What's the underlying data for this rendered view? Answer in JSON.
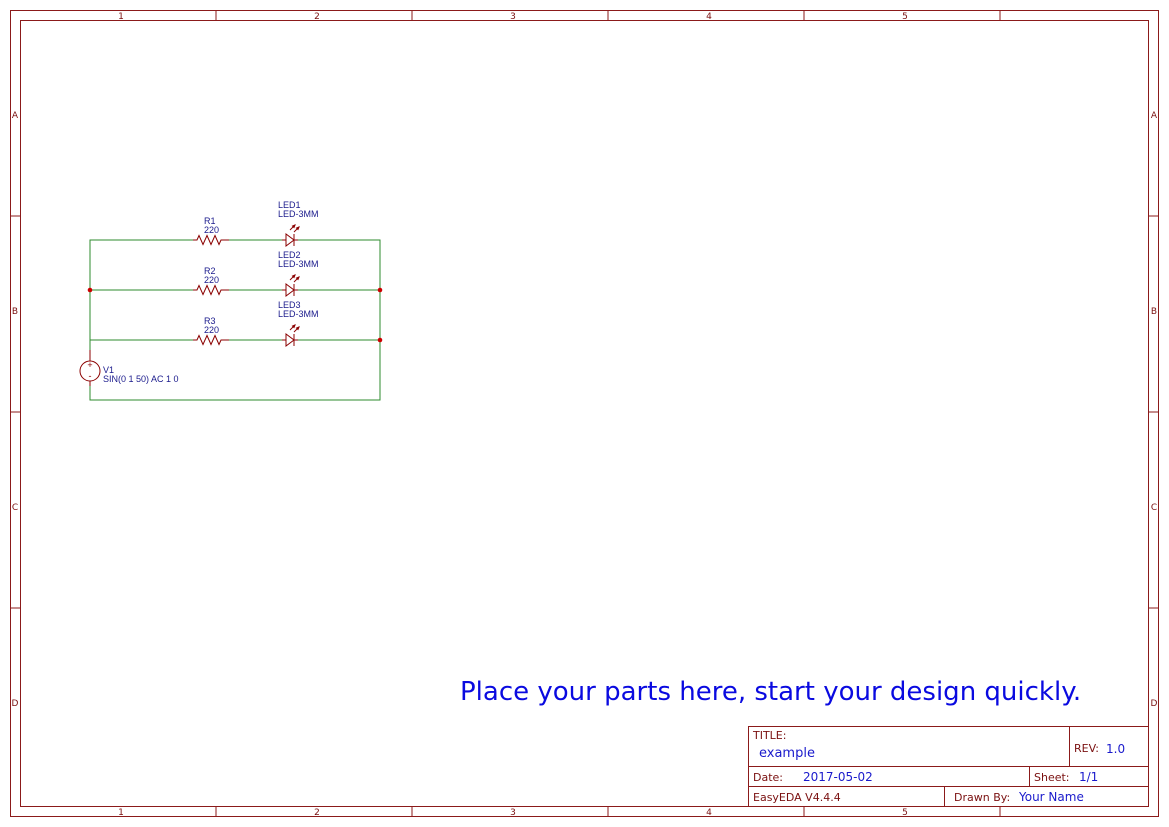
{
  "frame": {
    "columns": [
      "1",
      "2",
      "3",
      "4",
      "5"
    ],
    "rows": [
      "A",
      "B",
      "C",
      "D"
    ]
  },
  "schematic": {
    "r1": {
      "ref": "R1",
      "value": "220"
    },
    "r2": {
      "ref": "R2",
      "value": "220"
    },
    "r3": {
      "ref": "R3",
      "value": "220"
    },
    "led1": {
      "ref": "LED1",
      "value": "LED-3MM"
    },
    "led2": {
      "ref": "LED2",
      "value": "LED-3MM"
    },
    "led3": {
      "ref": "LED3",
      "value": "LED-3MM"
    },
    "v1": {
      "ref": "V1",
      "value": "SIN(0 1 50) AC 1 0",
      "plus": "+",
      "minus": "-"
    },
    "colors": {
      "wire": "#2e8b2e",
      "part": "#8b0000",
      "junction": "#cc0000",
      "label": "#1a1a8c"
    }
  },
  "banner": "Place your parts here, start your design quickly.",
  "title_block": {
    "title_label": "TITLE:",
    "title": "example",
    "rev_label": "REV:",
    "rev": "1.0",
    "date_label": "Date:",
    "date": "2017-05-02",
    "sheet_label": "Sheet:",
    "sheet": "1/1",
    "software": "EasyEDA V4.4.4",
    "drawn_by_label": "Drawn By:",
    "drawn_by": "Your Name"
  }
}
